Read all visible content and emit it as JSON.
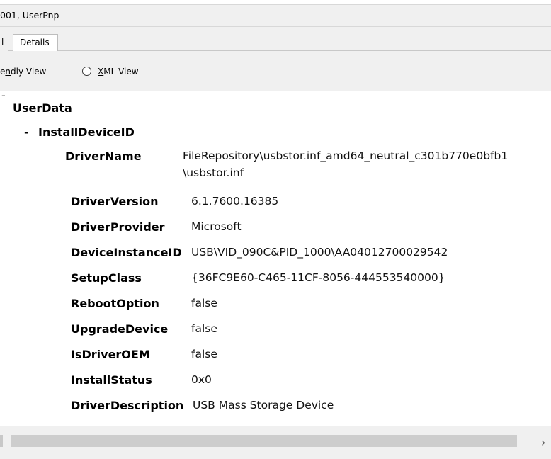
{
  "title": "001, UserPnp",
  "tabs": [
    {
      "label": "l"
    },
    {
      "label": "Details"
    }
  ],
  "view_options": {
    "friendly_prefix": "e",
    "friendly_underlined": "n",
    "friendly_rest": "dly View",
    "xml_underlined": "X",
    "xml_rest": "ML View"
  },
  "tree": {
    "collapse_marker": "-",
    "root": "UserData",
    "node_marker": "-",
    "node": "InstallDeviceID",
    "properties": [
      {
        "key": "DriverName",
        "value": "FileRepository\\usbstor.inf_amd64_neutral_c301b770e0bfb1",
        "value_cont": "\\usbstor.inf"
      },
      {
        "key": "DriverVersion",
        "value": "6.1.7600.16385"
      },
      {
        "key": "DriverProvider",
        "value": "Microsoft"
      },
      {
        "key": "DeviceInstanceID",
        "value": "USB\\VID_090C&PID_1000\\AA04012700029542"
      },
      {
        "key": "SetupClass",
        "value": "{36FC9E60-C465-11CF-8056-444553540000}"
      },
      {
        "key": "RebootOption",
        "value": "false"
      },
      {
        "key": "UpgradeDevice",
        "value": "false"
      },
      {
        "key": "IsDriverOEM",
        "value": "false"
      },
      {
        "key": "InstallStatus",
        "value": "0x0"
      },
      {
        "key": "DriverDescription",
        "value": "USB Mass Storage Device"
      }
    ]
  },
  "scrollbar": {
    "right_arrow": "›"
  }
}
